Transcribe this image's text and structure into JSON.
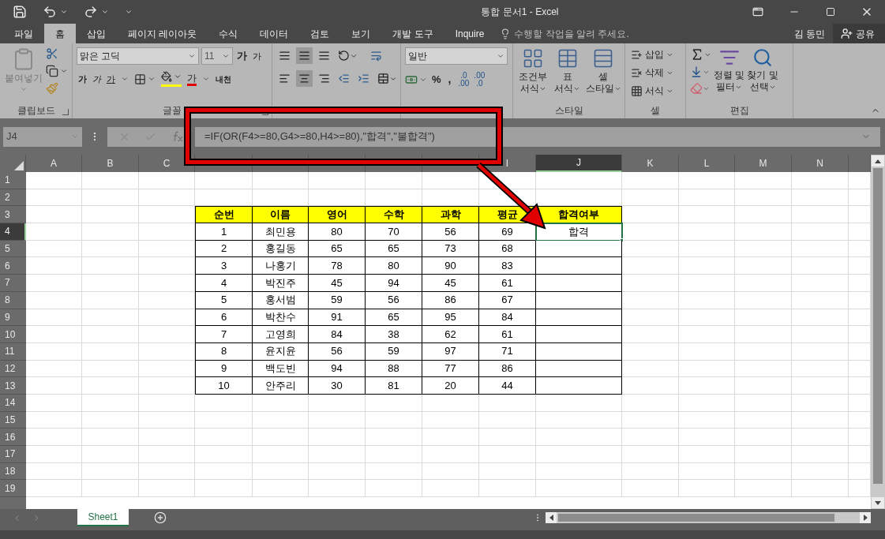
{
  "window": {
    "title": "통합 문서1 - Excel"
  },
  "menu_tabs": [
    {
      "label": "파일",
      "selected": false
    },
    {
      "label": "홈",
      "selected": true
    },
    {
      "label": "삽입",
      "selected": false
    },
    {
      "label": "페이지 레이아웃",
      "selected": false
    },
    {
      "label": "수식",
      "selected": false
    },
    {
      "label": "데이터",
      "selected": false
    },
    {
      "label": "검토",
      "selected": false
    },
    {
      "label": "보기",
      "selected": false
    },
    {
      "label": "개발 도구",
      "selected": false
    },
    {
      "label": "Inquire",
      "selected": false
    }
  ],
  "tell_me": {
    "placeholder": "수행할 작업을 알려 주세요."
  },
  "user": "김 동민",
  "share_button": "공유",
  "ribbon": {
    "clipboard": {
      "label": "클립보드",
      "paste": "붙여넣기"
    },
    "font": {
      "label": "글꼴",
      "font_name": "맑은 고딕",
      "font_size": "11",
      "grow": "가",
      "shrink": "가",
      "bold": "가",
      "italic": "가",
      "underline": "가",
      "font_color": "가",
      "phonetic": "내천"
    },
    "number": {
      "format": "일반",
      "percent": "%",
      "comma": ",",
      "increase_decimal": [
        ".0",
        ".00"
      ],
      "decrease_decimal": [
        ".00",
        ".0"
      ]
    },
    "styles": {
      "label": "스타일",
      "buttons": [
        {
          "top": "조건부",
          "bottom": "서식"
        },
        {
          "top": "표",
          "bottom": "서식"
        },
        {
          "top": "셀",
          "bottom": "스타일"
        }
      ]
    },
    "cells": {
      "label": "셀",
      "buttons": [
        "삽입",
        "삭제",
        "서식"
      ]
    },
    "editing": {
      "label": "편집",
      "sort": {
        "top": "정렬 및",
        "bottom": "필터"
      },
      "find": {
        "top": "찾기 및",
        "bottom": "선택"
      }
    }
  },
  "name_box": "J4",
  "formula": "=IF(OR(F4>=80,G4>=80,H4>=80),\"합격\",\"불합격\")",
  "column_headers": [
    {
      "label": "A",
      "selected": false
    },
    {
      "label": "B",
      "selected": false
    },
    {
      "label": "C",
      "selected": false
    },
    {
      "covered": true
    },
    {
      "covered": true
    },
    {
      "covered": true
    },
    {
      "covered": true
    },
    {
      "covered": true
    },
    {
      "label": "I",
      "selected": false
    },
    {
      "label": "J",
      "selected": true
    },
    {
      "label": "K",
      "selected": false
    },
    {
      "label": "L",
      "selected": false
    },
    {
      "label": "M",
      "selected": false
    },
    {
      "label": "N",
      "selected": false
    }
  ],
  "row_headers": [
    {
      "label": "1",
      "selected": false
    },
    {
      "label": "2",
      "selected": false
    },
    {
      "label": "3",
      "selected": false
    },
    {
      "label": "4",
      "selected": true
    },
    {
      "label": "5",
      "selected": false
    },
    {
      "label": "6",
      "selected": false
    },
    {
      "label": "7",
      "selected": false
    },
    {
      "label": "8",
      "selected": false
    },
    {
      "label": "9",
      "selected": false
    },
    {
      "label": "10",
      "selected": false
    },
    {
      "label": "11",
      "selected": false
    },
    {
      "label": "12",
      "selected": false
    },
    {
      "label": "13",
      "selected": false
    },
    {
      "label": "14",
      "selected": false
    },
    {
      "label": "15",
      "selected": false
    },
    {
      "label": "16",
      "selected": false
    },
    {
      "label": "17",
      "selected": false
    },
    {
      "label": "18",
      "selected": false
    },
    {
      "label": "19",
      "selected": false
    }
  ],
  "table": {
    "columns": [
      "순번",
      "이름",
      "영어",
      "수학",
      "과학",
      "평균",
      "합격여부"
    ],
    "rows": [
      {
        "cells": [
          "1",
          "최민용",
          "80",
          "70",
          "56",
          "69"
        ],
        "result": {
          "text": "합격",
          "selected": true
        }
      },
      {
        "cells": [
          "2",
          "홍길동",
          "65",
          "65",
          "73",
          "68"
        ],
        "result": {
          "selected": false
        }
      },
      {
        "cells": [
          "3",
          "나홍기",
          "78",
          "80",
          "90",
          "83"
        ],
        "result": {
          "selected": false
        }
      },
      {
        "cells": [
          "4",
          "박진주",
          "45",
          "94",
          "45",
          "61"
        ],
        "result": {
          "selected": false
        }
      },
      {
        "cells": [
          "5",
          "홍서범",
          "59",
          "56",
          "86",
          "67"
        ],
        "result": {
          "selected": false
        }
      },
      {
        "cells": [
          "6",
          "박찬수",
          "91",
          "65",
          "95",
          "84"
        ],
        "result": {
          "selected": false
        }
      },
      {
        "cells": [
          "7",
          "고영희",
          "84",
          "38",
          "62",
          "61"
        ],
        "result": {
          "selected": false
        }
      },
      {
        "cells": [
          "8",
          "윤지윤",
          "56",
          "59",
          "97",
          "71"
        ],
        "result": {
          "selected": false
        }
      },
      {
        "cells": [
          "9",
          "백도빈",
          "94",
          "88",
          "77",
          "86"
        ],
        "result": {
          "selected": false
        }
      },
      {
        "cells": [
          "10",
          "안주리",
          "30",
          "81",
          "20",
          "44"
        ],
        "result": {
          "selected": false
        }
      }
    ]
  },
  "sheet_tabs": [
    {
      "label": "Sheet1",
      "selected": true
    }
  ]
}
